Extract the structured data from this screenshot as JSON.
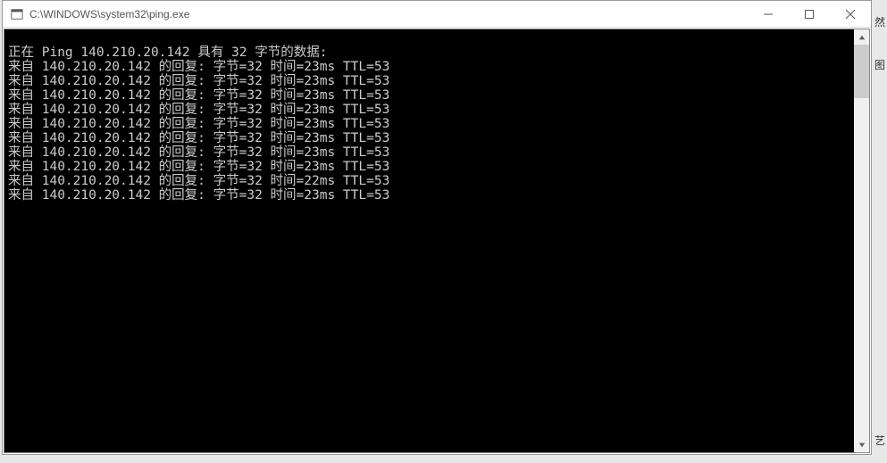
{
  "window": {
    "title": "C:\\WINDOWS\\system32\\ping.exe"
  },
  "console": {
    "header": "正在 Ping 140.210.20.142 具有 32 字节的数据:",
    "lines": [
      "来自 140.210.20.142 的回复: 字节=32 时间=23ms TTL=53",
      "来自 140.210.20.142 的回复: 字节=32 时间=23ms TTL=53",
      "来自 140.210.20.142 的回复: 字节=32 时间=23ms TTL=53",
      "来自 140.210.20.142 的回复: 字节=32 时间=23ms TTL=53",
      "来自 140.210.20.142 的回复: 字节=32 时间=23ms TTL=53",
      "来自 140.210.20.142 的回复: 字节=32 时间=23ms TTL=53",
      "来自 140.210.20.142 的回复: 字节=32 时间=23ms TTL=53",
      "来自 140.210.20.142 的回复: 字节=32 时间=23ms TTL=53",
      "来自 140.210.20.142 的回复: 字节=32 时间=22ms TTL=53",
      "来自 140.210.20.142 的回复: 字节=32 时间=23ms TTL=53"
    ]
  },
  "bg": {
    "frag1": "然",
    "frag2": "图",
    "frag3": "艺"
  }
}
